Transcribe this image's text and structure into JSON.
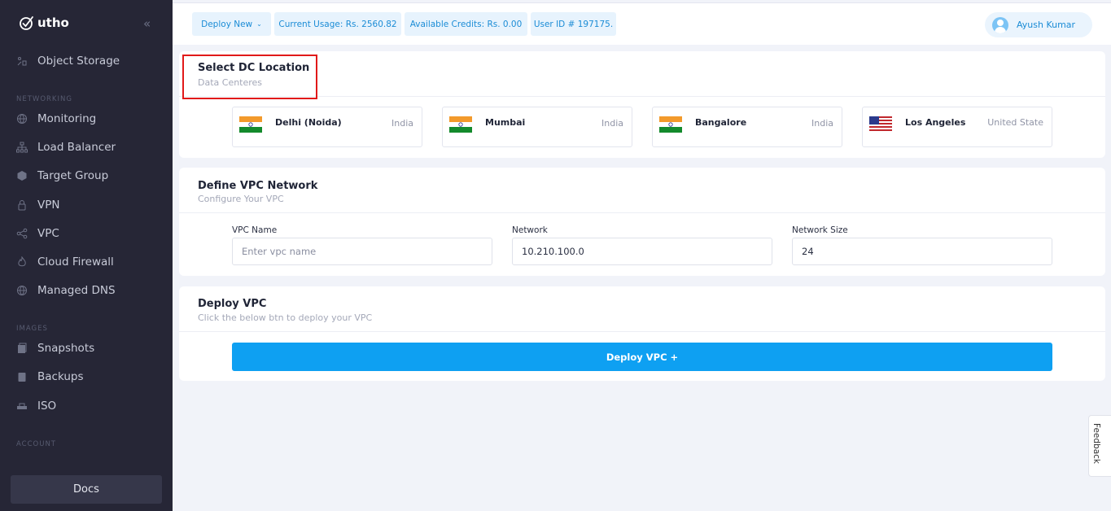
{
  "sidebar": {
    "logo": "utho",
    "items_top": [
      {
        "label": "Object Storage",
        "icon": "object-storage-icon"
      }
    ],
    "sections": [
      {
        "label": "NETWORKING",
        "items": [
          {
            "label": "Monitoring",
            "icon": "globe-icon"
          },
          {
            "label": "Load Balancer",
            "icon": "load-balancer-icon"
          },
          {
            "label": "Target Group",
            "icon": "target-group-icon"
          },
          {
            "label": "VPN",
            "icon": "lock-icon"
          },
          {
            "label": "VPC",
            "icon": "share-icon"
          },
          {
            "label": "Cloud Firewall",
            "icon": "firewall-icon"
          },
          {
            "label": "Managed DNS",
            "icon": "globe-icon"
          }
        ]
      },
      {
        "label": "IMAGES",
        "items": [
          {
            "label": "Snapshots",
            "icon": "snapshot-icon"
          },
          {
            "label": "Backups",
            "icon": "backup-icon"
          },
          {
            "label": "ISO",
            "icon": "iso-icon"
          }
        ]
      },
      {
        "label": "ACCOUNT",
        "items": []
      }
    ],
    "docs_label": "Docs"
  },
  "topbar": {
    "deploy_new": "Deploy New",
    "current_usage": "Current Usage: Rs. 2560.82",
    "available_credits": "Available Credits: Rs. 0.00",
    "user_id": "User ID # 197175.",
    "user_name": "Ayush Kumar"
  },
  "dc_card": {
    "title": "Select DC Location",
    "subtitle": "Data Centeres",
    "locations": [
      {
        "city": "Delhi (Noida)",
        "country": "India",
        "flag": "india-flag-icon"
      },
      {
        "city": "Mumbai",
        "country": "India",
        "flag": "india-flag-icon"
      },
      {
        "city": "Bangalore",
        "country": "India",
        "flag": "india-flag-icon"
      },
      {
        "city": "Los Angeles",
        "country": "United State",
        "flag": "usa-flag-icon"
      }
    ]
  },
  "vpc_card": {
    "title": "Define VPC Network",
    "subtitle": "Configure Your VPC",
    "fields": {
      "vpc_name": {
        "label": "VPC Name",
        "placeholder": "Enter vpc name",
        "value": ""
      },
      "network": {
        "label": "Network",
        "value": "10.210.100.0"
      },
      "network_size": {
        "label": "Network Size",
        "value": "24"
      }
    }
  },
  "deploy_card": {
    "title": "Deploy VPC",
    "subtitle": "Click the below btn to deploy your VPC",
    "button_label": "Deploy VPC +"
  },
  "feedback_label": "Feedback",
  "colors": {
    "sidebar_bg": "#262636",
    "accent": "#0ea0f2",
    "chip_bg": "#e7f3fd",
    "highlight": "#e11919"
  }
}
